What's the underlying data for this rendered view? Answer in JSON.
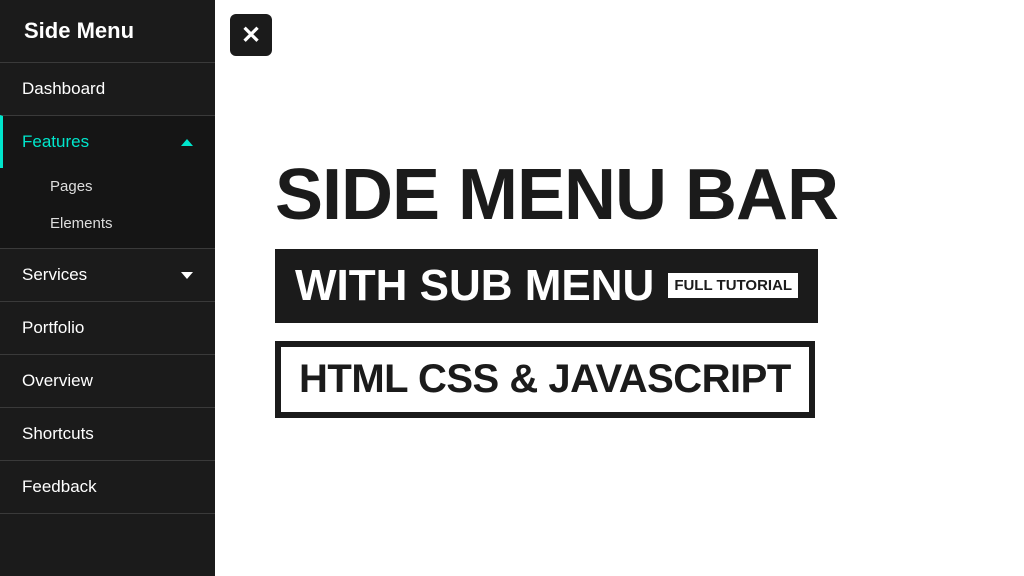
{
  "sidebar": {
    "title": "Side Menu",
    "items": {
      "dashboard": "Dashboard",
      "features": "Features",
      "services": "Services",
      "portfolio": "Portfolio",
      "overview": "Overview",
      "shortcuts": "Shortcuts",
      "feedback": "Feedback"
    },
    "submenu": {
      "pages": "Pages",
      "elements": "Elements"
    }
  },
  "toggle": "✕",
  "content": {
    "headline": "SIDE MENU BAR",
    "subhead": "WITH SUB MENU",
    "badge": "FULL TUTORIAL",
    "tech": "HTML CSS & JAVASCRIPT"
  }
}
